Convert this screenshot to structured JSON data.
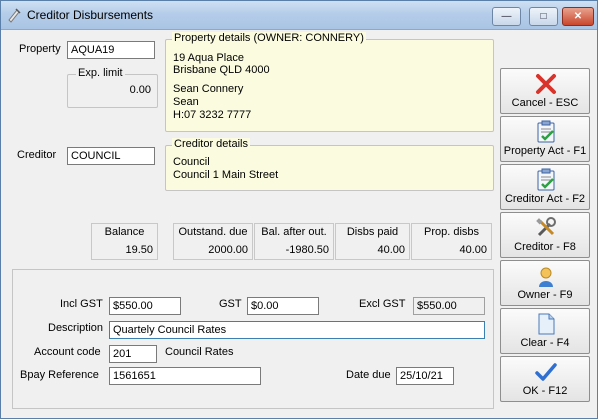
{
  "window": {
    "title": "Creditor Disbursements"
  },
  "property": {
    "label": "Property",
    "value": "AQUA19",
    "exp_limit_label": "Exp. limit",
    "exp_limit_value": "0.00",
    "details_legend": "Property details  (OWNER:  CONNERY)",
    "details_lines": [
      "19 Aqua Place",
      "Brisbane  QLD  4000",
      "",
      "Sean Connery",
      "Sean",
      "H:07 3232 7777"
    ]
  },
  "creditor": {
    "label": "Creditor",
    "value": "COUNCIL",
    "details_legend": "Creditor details",
    "details_lines": [
      "Council",
      "Council 1 Main Street"
    ]
  },
  "stats": [
    {
      "label": "Balance",
      "value": "19.50"
    },
    {
      "label": "Outstand. due",
      "value": "2000.00"
    },
    {
      "label": "Bal. after out.",
      "value": "-1980.50"
    },
    {
      "label": "Disbs paid",
      "value": "40.00"
    },
    {
      "label": "Prop. disbs",
      "value": "40.00"
    }
  ],
  "form": {
    "incl_gst_label": "Incl GST",
    "incl_gst_value": "$550.00",
    "gst_label": "GST",
    "gst_value": "$0.00",
    "excl_gst_label": "Excl GST",
    "excl_gst_value": "$550.00",
    "description_label": "Description",
    "description_value": "Quartely Council Rates",
    "account_code_label": "Account code",
    "account_code_value": "201",
    "account_name": "Council Rates",
    "bpay_label": "Bpay Reference",
    "bpay_value": "1561651",
    "date_due_label": "Date due",
    "date_due_value": "25/10/21"
  },
  "buttons": [
    {
      "label": "Cancel - ESC",
      "icon": "red-x-icon"
    },
    {
      "label": "Property Act - F1",
      "icon": "clipboard-check-icon"
    },
    {
      "label": "Creditor Act - F2",
      "icon": "clipboard-check-icon"
    },
    {
      "label": "Creditor - F8",
      "icon": "tools-icon"
    },
    {
      "label": "Owner - F9",
      "icon": "person-icon"
    },
    {
      "label": "Clear - F4",
      "icon": "blank-document-icon"
    },
    {
      "label": "OK - F12",
      "icon": "checkmark-icon"
    }
  ],
  "colors": {
    "details_bg": "#fbfbe0",
    "cancel_icon": "#d9342b",
    "ok_icon": "#2f6fd1"
  }
}
